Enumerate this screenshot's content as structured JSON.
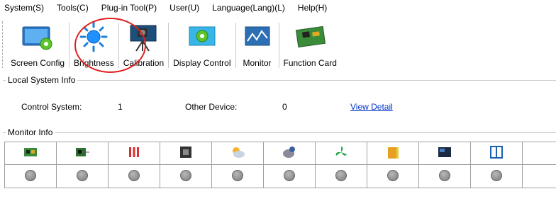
{
  "menu": [
    "System(S)",
    "Tools(C)",
    "Plug-in Tool(P)",
    "User(U)",
    "Language(Lang)(L)",
    "Help(H)"
  ],
  "toolbar": {
    "screen_config": "Screen Config",
    "brightness": "Brightness",
    "calibration": "Calibration",
    "display_control": "Display Control",
    "monitor": "Monitor",
    "function_card": "Function Card"
  },
  "local_system_info": {
    "title": "Local System Info",
    "control_system_label": "Control System:",
    "control_system_value": "1",
    "other_device_label": "Other Device:",
    "other_device_value": "0",
    "view_detail": "View Detail"
  },
  "monitor_info": {
    "title": "Monitor Info",
    "columns": [
      "receiving-card-icon",
      "sending-card-icon",
      "temperature-icon",
      "chip-icon",
      "weather-icon",
      "smoke-icon",
      "fan-icon",
      "power-icon",
      "screen-icon",
      "cabinet-door-icon"
    ],
    "status": [
      "unknown",
      "unknown",
      "unknown",
      "unknown",
      "unknown",
      "unknown",
      "unknown",
      "unknown",
      "unknown",
      "unknown"
    ]
  },
  "colors": {
    "highlight": "#e02020",
    "link": "#0033cc",
    "status_dot": "#8a8a8a"
  }
}
